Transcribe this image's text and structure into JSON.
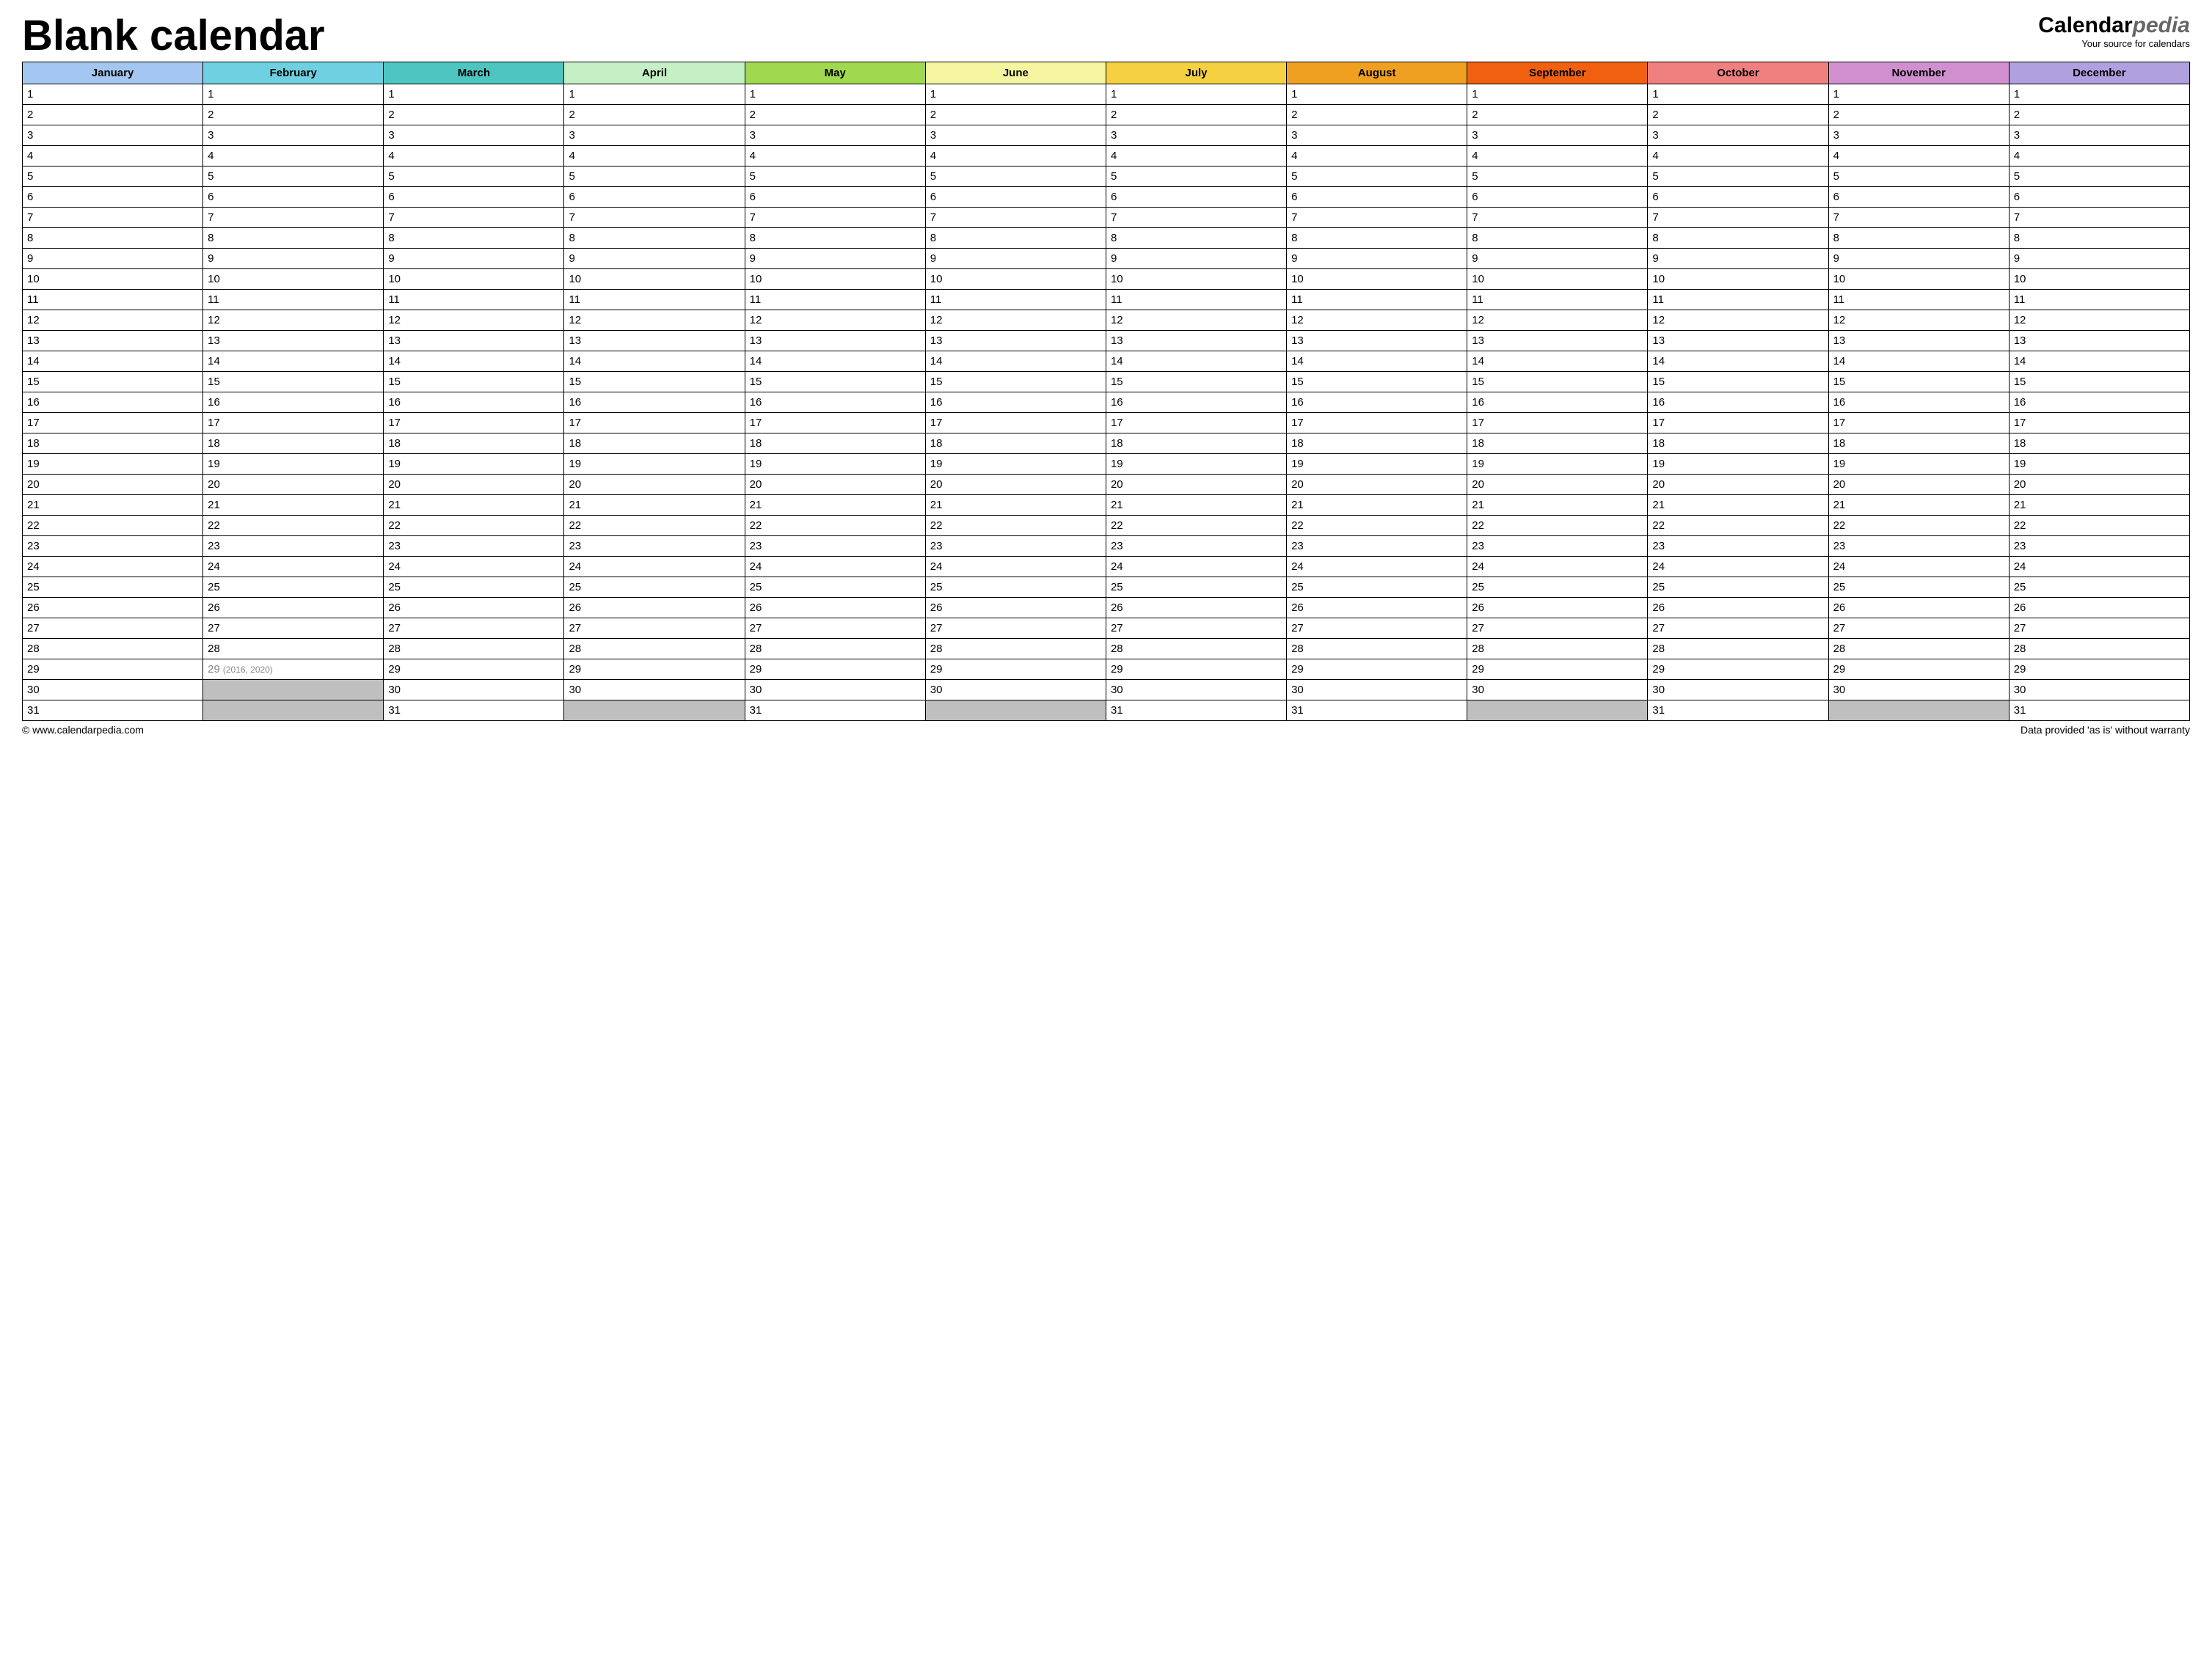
{
  "header": {
    "title": "Blank calendar",
    "brand_prefix": "Calendar",
    "brand_suffix": "pedia",
    "brand_tagline": "Your source for calendars"
  },
  "months": [
    {
      "name": "January",
      "color": "#a3c7f0",
      "days": 31
    },
    {
      "name": "February",
      "color": "#6ed0e0",
      "days": 29,
      "leap_day": 29,
      "leap_note": "(2016, 2020)"
    },
    {
      "name": "March",
      "color": "#4ec5c1",
      "days": 31
    },
    {
      "name": "April",
      "color": "#c5f0c5",
      "days": 30
    },
    {
      "name": "May",
      "color": "#a0d850",
      "days": 31
    },
    {
      "name": "June",
      "color": "#f5f5a0",
      "days": 30
    },
    {
      "name": "July",
      "color": "#f5d040",
      "days": 31
    },
    {
      "name": "August",
      "color": "#f0a020",
      "days": 31
    },
    {
      "name": "September",
      "color": "#f06010",
      "days": 30
    },
    {
      "name": "October",
      "color": "#f08080",
      "days": 31
    },
    {
      "name": "November",
      "color": "#d090d0",
      "days": 30
    },
    {
      "name": "December",
      "color": "#b0a0e0",
      "days": 31
    }
  ],
  "max_rows": 31,
  "footer": {
    "copyright": "© www.calendarpedia.com",
    "warranty": "Data provided 'as is' without warranty"
  }
}
